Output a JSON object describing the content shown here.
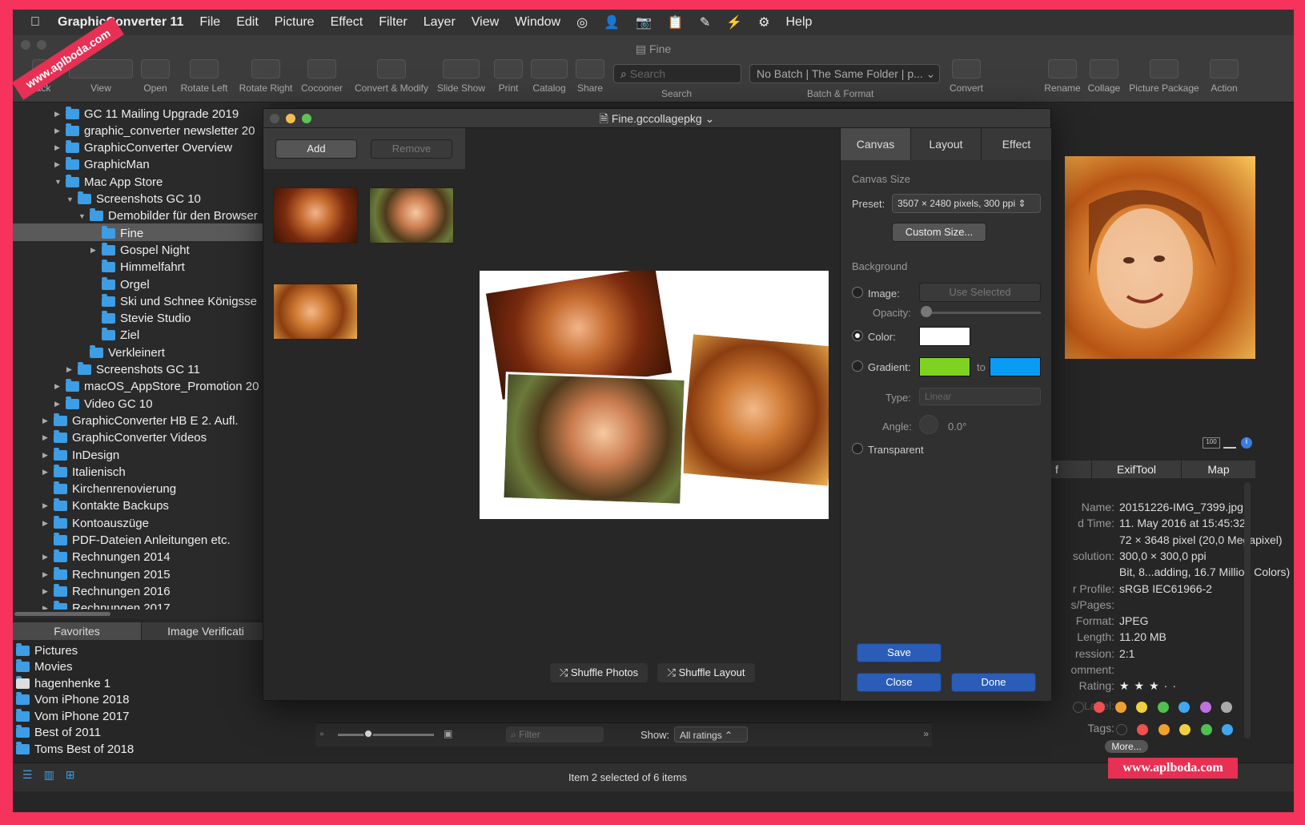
{
  "menubar": {
    "apple": "",
    "app_name": "GraphicConverter 11",
    "items": [
      "File",
      "Edit",
      "Picture",
      "Effect",
      "Filter",
      "Layer",
      "View",
      "Window"
    ],
    "help": "Help"
  },
  "toolbar": {
    "window_title": "Fine",
    "buttons": {
      "back": "Back",
      "view": "View",
      "open": "Open",
      "rotate_left": "Rotate Left",
      "rotate_right": "Rotate Right",
      "cocooner": "Cocooner",
      "convert_modify": "Convert & Modify",
      "slide_show": "Slide Show",
      "print": "Print",
      "catalog": "Catalog",
      "share": "Share",
      "search": "Search",
      "batch_format": "Batch & Format",
      "convert": "Convert",
      "rename": "Rename",
      "collage": "Collage",
      "picture_package": "Picture Package",
      "action": "Action"
    },
    "search_placeholder": "Search",
    "batch_value": "No Batch | The Same Folder | p..."
  },
  "sidebar": {
    "tree": [
      {
        "label": "GC 11 Mailing Upgrade 2019",
        "level": 2,
        "tri": "right"
      },
      {
        "label": "graphic_converter newsletter 20",
        "level": 2,
        "tri": "right"
      },
      {
        "label": "GraphicConverter Overview",
        "level": 2,
        "tri": "right"
      },
      {
        "label": "GraphicMan",
        "level": 2,
        "tri": "right"
      },
      {
        "label": "Mac App Store",
        "level": 2,
        "tri": "down"
      },
      {
        "label": "Screenshots GC 10",
        "level": 3,
        "tri": "down"
      },
      {
        "label": "Demobilder für den Browser",
        "level": 4,
        "tri": "down"
      },
      {
        "label": "Fine",
        "level": 5,
        "tri": "none",
        "selected": true
      },
      {
        "label": "Gospel Night",
        "level": 5,
        "tri": "right"
      },
      {
        "label": "Himmelfahrt",
        "level": 5,
        "tri": "none"
      },
      {
        "label": "Orgel",
        "level": 5,
        "tri": "none"
      },
      {
        "label": "Ski und Schnee Königsse",
        "level": 5,
        "tri": "none"
      },
      {
        "label": "Stevie Studio",
        "level": 5,
        "tri": "none"
      },
      {
        "label": "Ziel",
        "level": 5,
        "tri": "none"
      },
      {
        "label": "Verkleinert",
        "level": 4,
        "tri": "none"
      },
      {
        "label": "Screenshots GC 11",
        "level": 3,
        "tri": "right"
      },
      {
        "label": "macOS_AppStore_Promotion 20",
        "level": 2,
        "tri": "right"
      },
      {
        "label": "Video GC 10",
        "level": 2,
        "tri": "right"
      },
      {
        "label": "GraphicConverter HB E 2. Aufl.",
        "level": 1,
        "tri": "right"
      },
      {
        "label": "GraphicConverter Videos",
        "level": 1,
        "tri": "right"
      },
      {
        "label": "InDesign",
        "level": 1,
        "tri": "right"
      },
      {
        "label": "Italienisch",
        "level": 1,
        "tri": "right"
      },
      {
        "label": "Kirchenrenovierung",
        "level": 1,
        "tri": "none"
      },
      {
        "label": "Kontakte Backups",
        "level": 1,
        "tri": "right"
      },
      {
        "label": "Kontoauszüge",
        "level": 1,
        "tri": "right"
      },
      {
        "label": "PDF-Dateien Anleitungen etc.",
        "level": 1,
        "tri": "none"
      },
      {
        "label": "Rechnungen 2014",
        "level": 1,
        "tri": "right"
      },
      {
        "label": "Rechnungen 2015",
        "level": 1,
        "tri": "right"
      },
      {
        "label": "Rechnungen 2016",
        "level": 1,
        "tri": "right"
      },
      {
        "label": "Rechnungen 2017",
        "level": 1,
        "tri": "right"
      }
    ],
    "tabs": {
      "favorites": "Favorites",
      "image_verification": "Image Verificati"
    },
    "favorites": [
      "Pictures",
      "Movies",
      "hagenhenke 1",
      "Vom iPhone 2018",
      "Vom iPhone 2017",
      "Best of 2011",
      "Toms Best of 2018"
    ]
  },
  "dialog": {
    "title": "Fine.gccollagepkg",
    "add": "Add",
    "remove": "Remove",
    "shuffle_photos": "Shuffle Photos",
    "shuffle_layout": "Shuffle Layout",
    "tabs": [
      "Canvas",
      "Layout",
      "Effect"
    ],
    "canvas_size_label": "Canvas Size",
    "preset_label": "Preset:",
    "preset_value": "3507 × 2480 pixels, 300 ppi",
    "custom_size": "Custom Size...",
    "background_label": "Background",
    "image_label": "Image:",
    "use_selected": "Use Selected",
    "opacity_label": "Opacity:",
    "color_label": "Color:",
    "gradient_label": "Gradient:",
    "to": "to",
    "type_label": "Type:",
    "type_value": "Linear",
    "angle_label": "Angle:",
    "angle_value": "0.0°",
    "transparent_label": "Transparent",
    "save": "Save",
    "close": "Close",
    "done": "Done",
    "colors": {
      "bg": "#ffffff",
      "grad_from": "#7ed321",
      "grad_to": "#0a9bf5"
    }
  },
  "right": {
    "tabs": {
      "partial": "f",
      "exiftool": "ExifTool",
      "map": "Map"
    },
    "info": [
      {
        "k": "Name:",
        "v": "20151226-IMG_7399.jpg"
      },
      {
        "k": "d Time:",
        "v": "11. May 2016 at 15:45:32"
      },
      {
        "k": "",
        "v": "72 × 3648 pixel (20,0 Megapixel)"
      },
      {
        "k": "solution:",
        "v": "300,0 × 300,0 ppi"
      },
      {
        "k": "",
        "v": "Bit, 8...adding, 16.7 Million Colors)"
      },
      {
        "k": "r Profile:",
        "v": "sRGB IEC61966-2"
      },
      {
        "k": "s/Pages:",
        "v": ""
      },
      {
        "k": "Format:",
        "v": "JPEG"
      },
      {
        "k": "Length:",
        "v": "11.20 MB"
      },
      {
        "k": "ression:",
        "v": "2:1"
      },
      {
        "k": "omment:",
        "v": ""
      }
    ],
    "rating_label": "Rating:",
    "rating_value": 3,
    "rating_max": 5,
    "label_label": "Label:",
    "tags_label": "Tags:",
    "more": "More...",
    "label_colors": [
      "#f05050",
      "#f0a030",
      "#f0d040",
      "#50c050",
      "#40a8f0",
      "#c070e0",
      "#aaaaaa"
    ],
    "tag_colors": [
      "#f05050",
      "#f0a030",
      "#f0d040",
      "#50c050",
      "#40a8f0"
    ]
  },
  "bottom": {
    "filter_placeholder": "Filter",
    "show_label": "Show:",
    "show_value": "All ratings",
    "status_text": "Item 2 selected of 6 items"
  },
  "watermark": "www.aplboda.com"
}
